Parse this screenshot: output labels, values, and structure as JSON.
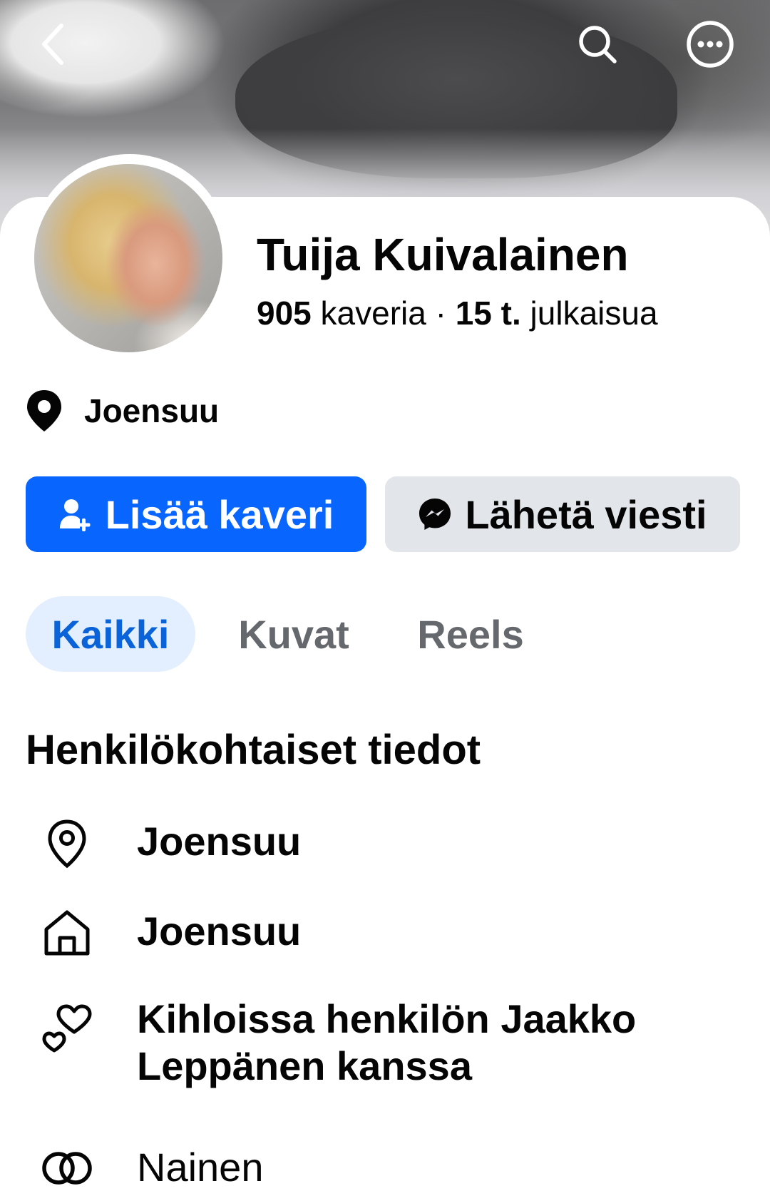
{
  "header": {
    "back_icon": "chevron-left-icon",
    "search_icon": "search-icon",
    "more_icon": "more-horizontal-circle-icon"
  },
  "profile": {
    "name": "Tuija Kuivalainen",
    "friends_count": "905",
    "friends_label": "kaveria",
    "separator": "·",
    "posts_count": "15 t.",
    "posts_label": "julkaisua",
    "location": "Joensuu"
  },
  "actions": {
    "add_friend_label": "Lisää kaveri",
    "message_label": "Lähetä viesti",
    "primary_color": "#0866ff"
  },
  "tabs": [
    {
      "label": "Kaikki",
      "active": true
    },
    {
      "label": "Kuvat",
      "active": false
    },
    {
      "label": "Reels",
      "active": false
    }
  ],
  "details": {
    "title": "Henkilökohtaiset tiedot",
    "items": [
      {
        "icon": "location-pin-outline-icon",
        "text": "Joensuu"
      },
      {
        "icon": "home-icon",
        "text": "Joensuu"
      },
      {
        "icon": "hearts-icon",
        "text_line1": "Kihloissa henkilön Jaakko",
        "text_line2": "Leppänen kanssa"
      },
      {
        "icon": "gender-rings-icon",
        "text": "Nainen"
      }
    ]
  }
}
